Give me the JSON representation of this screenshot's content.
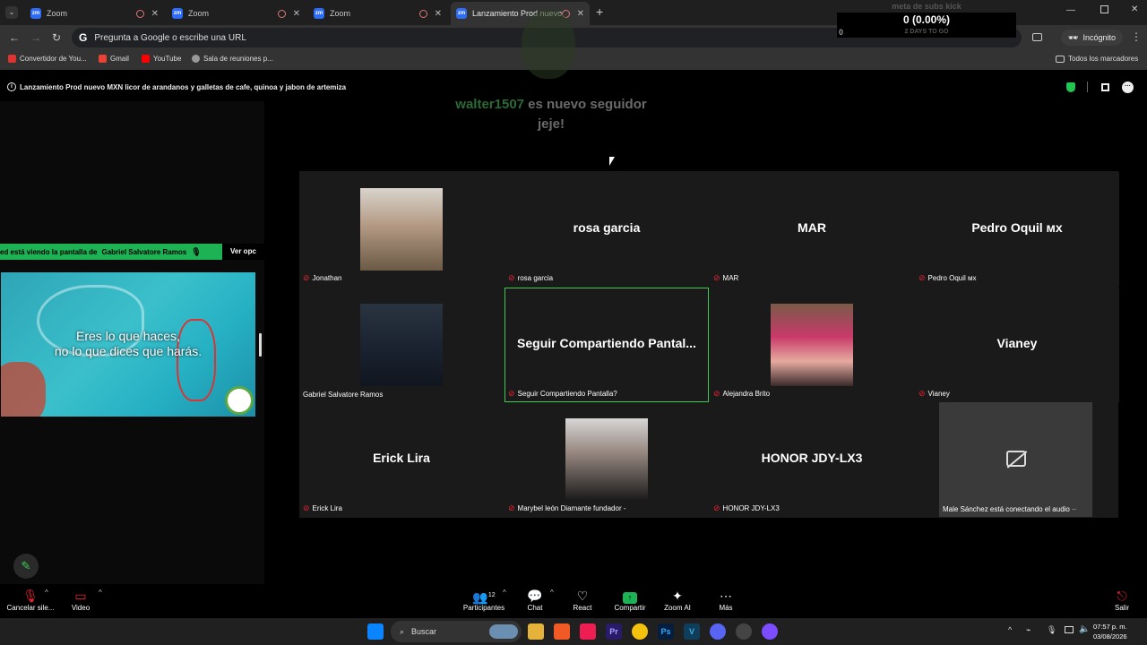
{
  "browser": {
    "tabs": [
      {
        "title": "Zoom"
      },
      {
        "title": "Zoom"
      },
      {
        "title": "Zoom"
      },
      {
        "title": "Lanzamiento Prod nuevo "
      }
    ],
    "new_tab": "+",
    "omnibox_placeholder": "Pregunta a Google o escribe una URL",
    "incognito_label": "Incógnito",
    "bookmarks": [
      {
        "label": "Convertidor de You..."
      },
      {
        "label": "Gmail"
      },
      {
        "label": "YouTube"
      },
      {
        "label": "Sala de reuniones p..."
      }
    ],
    "all_bookmarks": "Todos los marcadores"
  },
  "meeting": {
    "title": "Lanzamiento Prod nuevo MXN licor de arandanos y galletas de cafe, quinoa y jabon de artemiza"
  },
  "overlay": {
    "kick_title": "meta de subs kick",
    "kick_value": "0 (0.00%)",
    "kick_left": "0",
    "kick_days": "2 DAYS TO GO",
    "follower_name": "walter1507",
    "follower_text": " es nuevo seguidor jeje!"
  },
  "share": {
    "viewing_text": "ed está viendo la pantalla de",
    "presenter": "Gabriel Salvatore Ramos",
    "view_options": "Ver opc",
    "quote_line1": "Eres lo que haces,",
    "quote_line2": "no lo que dices que harás."
  },
  "participants": [
    {
      "label": "Jonathan",
      "big": "",
      "muted": true,
      "photo": "man-glasses"
    },
    {
      "label": "rosa garcia",
      "big": "rosa garcia",
      "muted": true
    },
    {
      "label": "MAR",
      "big": "MAR",
      "muted": true
    },
    {
      "label": "Pedro Oquil ᴍx",
      "big": "Pedro Oquil ᴍx",
      "muted": true
    },
    {
      "label": "Gabriel Salvatore Ramos",
      "big": "",
      "muted": false,
      "photo": "man-suit"
    },
    {
      "label": "Seguir Compartiendo Pantalla?",
      "big": "Seguir Compartiendo Pantal...",
      "muted": true
    },
    {
      "label": "Alejandra Brito",
      "big": "",
      "muted": true,
      "photo": "woman-pink-hair"
    },
    {
      "label": "Vianey",
      "big": "Vianey",
      "muted": true
    },
    {
      "label": "Erick Lira",
      "big": "Erick Lira",
      "muted": true
    },
    {
      "label": "Marybel león Diamante fundador -",
      "big": "",
      "muted": true,
      "photo": "woman-mic"
    },
    {
      "label": "HONOR JDY-LX3",
      "big": "HONOR JDY-LX3",
      "muted": true
    },
    {
      "label": "Male Sánchez está conectando el audio ··",
      "big": "",
      "muted": false,
      "photo": "video-off-icon"
    }
  ],
  "toolbar": {
    "mute_label": "Cancelar sile...",
    "video_label": "Video",
    "participants_label": "Participantes",
    "participants_count": "12",
    "chat_label": "Chat",
    "react_label": "React",
    "share_label": "Compartir",
    "ai_label": "Zoom AI",
    "more_label": "Más",
    "leave_label": "Salir"
  },
  "taskbar": {
    "search_label": "Buscar",
    "time": "07:57 p. m.",
    "date": "03/08/2026",
    "colors": {
      "accent": "#1db354",
      "active_border": "#3ccd4f",
      "share_btn": "#1db354"
    }
  }
}
